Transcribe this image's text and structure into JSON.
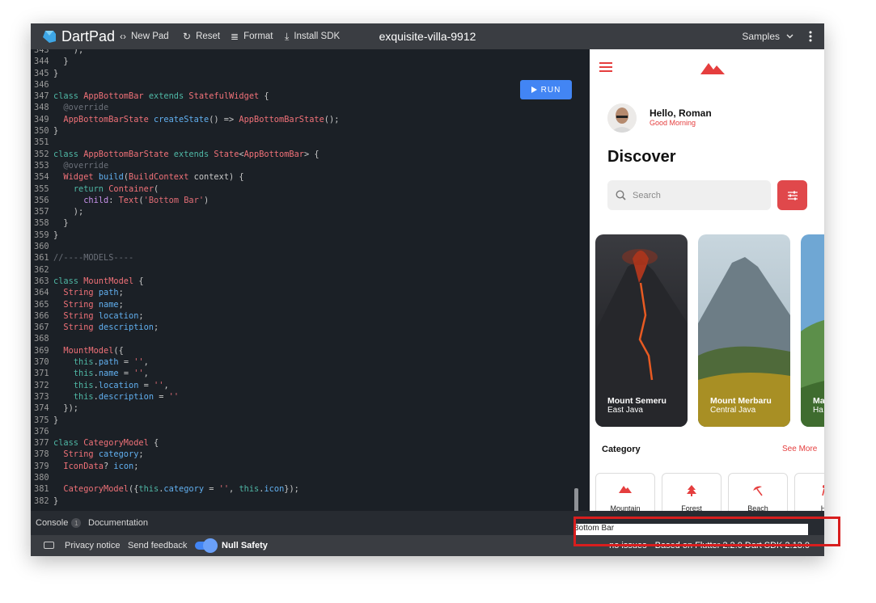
{
  "topbar": {
    "brand": "DartPad",
    "buttons": [
      {
        "icon": "code-brackets-icon",
        "glyph": "‹›",
        "label": "New Pad"
      },
      {
        "icon": "reset-icon",
        "glyph": "↻",
        "label": "Reset"
      },
      {
        "icon": "format-lines-icon",
        "glyph": "≣",
        "label": "Format"
      },
      {
        "icon": "download-icon",
        "glyph": "⤓",
        "label": "Install SDK"
      }
    ],
    "pad_title": "exquisite-villa-9912",
    "samples_label": "Samples"
  },
  "editor": {
    "run_label": "RUN",
    "lines": [
      {
        "n": "343",
        "html": "    );"
      },
      {
        "n": "344",
        "html": "  }"
      },
      {
        "n": "345",
        "html": "}"
      },
      {
        "n": "346",
        "html": ""
      },
      {
        "n": "347",
        "html": "<span class='kw'>class</span> <span class='ty'>AppBottomBar</span> <span class='kw'>extends</span> <span class='ty'>StatefulWidget</span> {"
      },
      {
        "n": "348",
        "html": "  <span class='cm'>@override</span>"
      },
      {
        "n": "349",
        "html": "  <span class='ty'>AppBottomBarState</span> <span class='fn'>createState</span>() => <span class='ty'>AppBottomBarState</span>();"
      },
      {
        "n": "350",
        "html": "}"
      },
      {
        "n": "351",
        "html": ""
      },
      {
        "n": "352",
        "html": "<span class='kw'>class</span> <span class='ty'>AppBottomBarState</span> <span class='kw'>extends</span> <span class='ty'>State</span>&lt;<span class='ty'>AppBottomBar</span>&gt; {"
      },
      {
        "n": "353",
        "html": "  <span class='cm'>@override</span>"
      },
      {
        "n": "354",
        "html": "  <span class='ty'>Widget</span> <span class='fn'>build</span>(<span class='ty'>BuildContext</span> context) {"
      },
      {
        "n": "355",
        "html": "    <span class='kw'>return</span> <span class='ty'>Container</span>("
      },
      {
        "n": "356",
        "html": "      <span class='vb'>child</span>: <span class='ty'>Text</span>(<span class='st'>'Bottom Bar'</span>)"
      },
      {
        "n": "357",
        "html": "    );"
      },
      {
        "n": "358",
        "html": "  }"
      },
      {
        "n": "359",
        "html": "}"
      },
      {
        "n": "360",
        "html": ""
      },
      {
        "n": "361",
        "html": "<span class='cm'>//----MODELS----</span>"
      },
      {
        "n": "362",
        "html": ""
      },
      {
        "n": "363",
        "html": "<span class='kw'>class</span> <span class='ty'>MountModel</span> {"
      },
      {
        "n": "364",
        "html": "  <span class='ty'>String</span> <span class='fn'>path</span>;"
      },
      {
        "n": "365",
        "html": "  <span class='ty'>String</span> <span class='fn'>name</span>;"
      },
      {
        "n": "366",
        "html": "  <span class='ty'>String</span> <span class='fn'>location</span>;"
      },
      {
        "n": "367",
        "html": "  <span class='ty'>String</span> <span class='fn'>description</span>;"
      },
      {
        "n": "368",
        "html": ""
      },
      {
        "n": "369",
        "html": "  <span class='ty'>MountModel</span>({"
      },
      {
        "n": "370",
        "html": "    <span class='kw'>this</span>.<span class='fn'>path</span> = <span class='st'>''</span>,"
      },
      {
        "n": "371",
        "html": "    <span class='kw'>this</span>.<span class='fn'>name</span> = <span class='st'>''</span>,"
      },
      {
        "n": "372",
        "html": "    <span class='kw'>this</span>.<span class='fn'>location</span> = <span class='st'>''</span>,"
      },
      {
        "n": "373",
        "html": "    <span class='kw'>this</span>.<span class='fn'>description</span> = <span class='st'>''</span>"
      },
      {
        "n": "374",
        "html": "  });"
      },
      {
        "n": "375",
        "html": "}"
      },
      {
        "n": "376",
        "html": ""
      },
      {
        "n": "377",
        "html": "<span class='kw'>class</span> <span class='ty'>CategoryModel</span> {"
      },
      {
        "n": "378",
        "html": "  <span class='ty'>String</span> <span class='fn'>category</span>;"
      },
      {
        "n": "379",
        "html": "  <span class='ty'>IconData</span>? <span class='fn'>icon</span>;"
      },
      {
        "n": "380",
        "html": ""
      },
      {
        "n": "381",
        "html": "  <span class='ty'>CategoryModel</span>({<span class='kw'>this</span>.<span class='fn'>category</span> = <span class='st'>''</span>, <span class='kw'>this</span>.<span class='fn'>icon</span>});"
      },
      {
        "n": "382",
        "html": "}"
      }
    ]
  },
  "console": {
    "label": "Console",
    "badge": "1",
    "documentation": "Documentation"
  },
  "statusbar": {
    "privacy": "Privacy notice",
    "feedback": "Send feedback",
    "null_safety": "Null Safety",
    "issues": "no issues",
    "sdk": "Based on Flutter 2.2.0 Dart SDK 2.13.0"
  },
  "preview": {
    "hello": "Hello, Roman",
    "greeting": "Good Morning",
    "discover": "Discover",
    "search_placeholder": "Search",
    "cards": [
      {
        "name": "Mount Semeru",
        "location": "East Java"
      },
      {
        "name": "Mount Merbaru",
        "location": "Central Java"
      },
      {
        "name": "Ma",
        "location": "Ha"
      }
    ],
    "category_title": "Category",
    "see_more": "See More",
    "categories": [
      {
        "label": "Mountain",
        "icon": "mountain-icon"
      },
      {
        "label": "Forest",
        "icon": "tree-icon"
      },
      {
        "label": "Beach",
        "icon": "umbrella-icon"
      },
      {
        "label": "Hi",
        "icon": "hiking-icon"
      }
    ],
    "bottom_bar": "Bottom Bar"
  },
  "colors": {
    "accent": "#e53e3e",
    "run": "#4285f4",
    "editor_bg": "#1b2026",
    "topbar_bg": "#3a3d42"
  }
}
